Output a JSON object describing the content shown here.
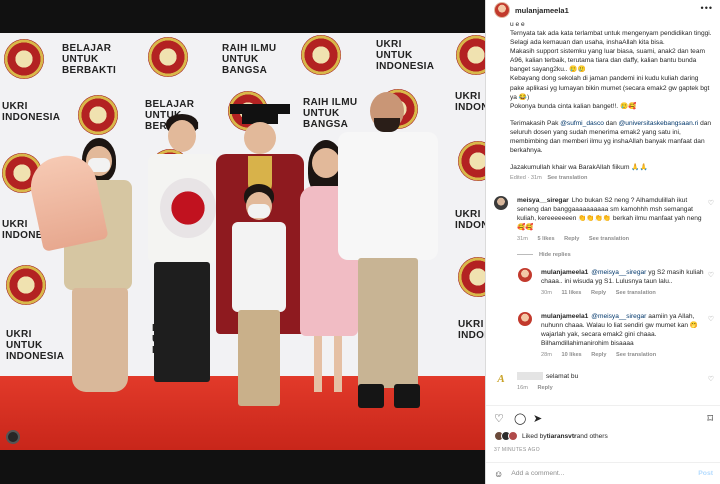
{
  "post": {
    "username": "mulanjameela1",
    "caption_lines": [
      "u e e",
      "Ternyata tak ada kata terlambat untuk mengenyam pendidikan tinggi.",
      "Selagi ada kemauan dan usaha, inshaAllah kita bisa.",
      "Makasih support sistemku yang luar biasa, suami, anak2 dan team A96, kalian terbaik, terutama tiara dan daffy, kalian bantu bunda banget sayang2ku.. 🥲🥲",
      "Kebayang dong sekolah di jaman pandemi ini kudu kuliah daring pake aplikasi yg lumayan bikin mumet (secara emak2 gw gaptek bgt ya 😂)",
      "Pokonya bunda cinta kalian banget!!. 🥲🥰"
    ],
    "thanks_prefix": "Terimakasih Pak ",
    "thanks_link1": "@sufmi_dasco",
    "thanks_mid": " dan ",
    "thanks_link2": "@universitaskebangsaan.ri",
    "thanks_rest": " dan seluruh dosen yang sudah menerima emak2 yang satu ini, membimbing dan memberi ilmu yg inshaAllah banyak manfaat dan berkahnya.",
    "closing": "Jazakumullah khair wa BarakAllah fiikum 🙏🙏",
    "edited": "Edited",
    "age": "31m",
    "see_translation": "See translation"
  },
  "comments": [
    {
      "user": "meisya__siregar",
      "text": "Lho bukan S2 neng ? Alhamdulillah ikut seneng dan banggaaaaaaaaaa sm kamohhh msh semangat kuliah, kereeeeeeen 👏👏👏👏 berkah ilmu manfaat yah neng 🥰🥰",
      "age": "31m",
      "likes": "5 likes",
      "reply": "Reply",
      "translate": "See translation",
      "hide_replies": "Hide replies"
    },
    {
      "user": "mulanjameela1",
      "mention": "@meisya__siregar",
      "text": " yg S2 masih kuliah chaaa.. ini wisuda yg S1. Lulusnya taun lalu..",
      "age": "30m",
      "likes": "11 likes",
      "reply": "Reply",
      "translate": "See translation"
    },
    {
      "user": "mulanjameela1",
      "mention": "@meisya__siregar",
      "text": " aamiin ya Allah, nuhunn chaaa. Walau lo liat sendiri gw mumet kan 🤭 wajarlah yak, secara emak2 gini chaaa. Bilhamdillahimanirohim bisaaaa",
      "age": "28m",
      "likes": "10 likes",
      "reply": "Reply",
      "translate": "See translation"
    },
    {
      "user": "",
      "text": "selamat bu",
      "age": "16m",
      "reply": "Reply"
    }
  ],
  "likes_line": {
    "prefix": "Liked by ",
    "user": "tiaransvtr",
    "suffix": " and others"
  },
  "date": "37 MINUTES AGO",
  "add_comment": {
    "placeholder": "Add a comment...",
    "post": "Post"
  },
  "backdrop_text": {
    "belajar": [
      "BELAJAR",
      "UNTUK",
      "BERBAKTI"
    ],
    "raih": [
      "RAIH ILMU",
      "UNTUK",
      "BANGSA"
    ],
    "ukri": [
      "UKRI",
      "UNTUK",
      "INDONESIA"
    ]
  },
  "colors": {
    "accent_link": "#00376b",
    "carpet": "#d4301f",
    "gown": "#8e1a1f"
  }
}
